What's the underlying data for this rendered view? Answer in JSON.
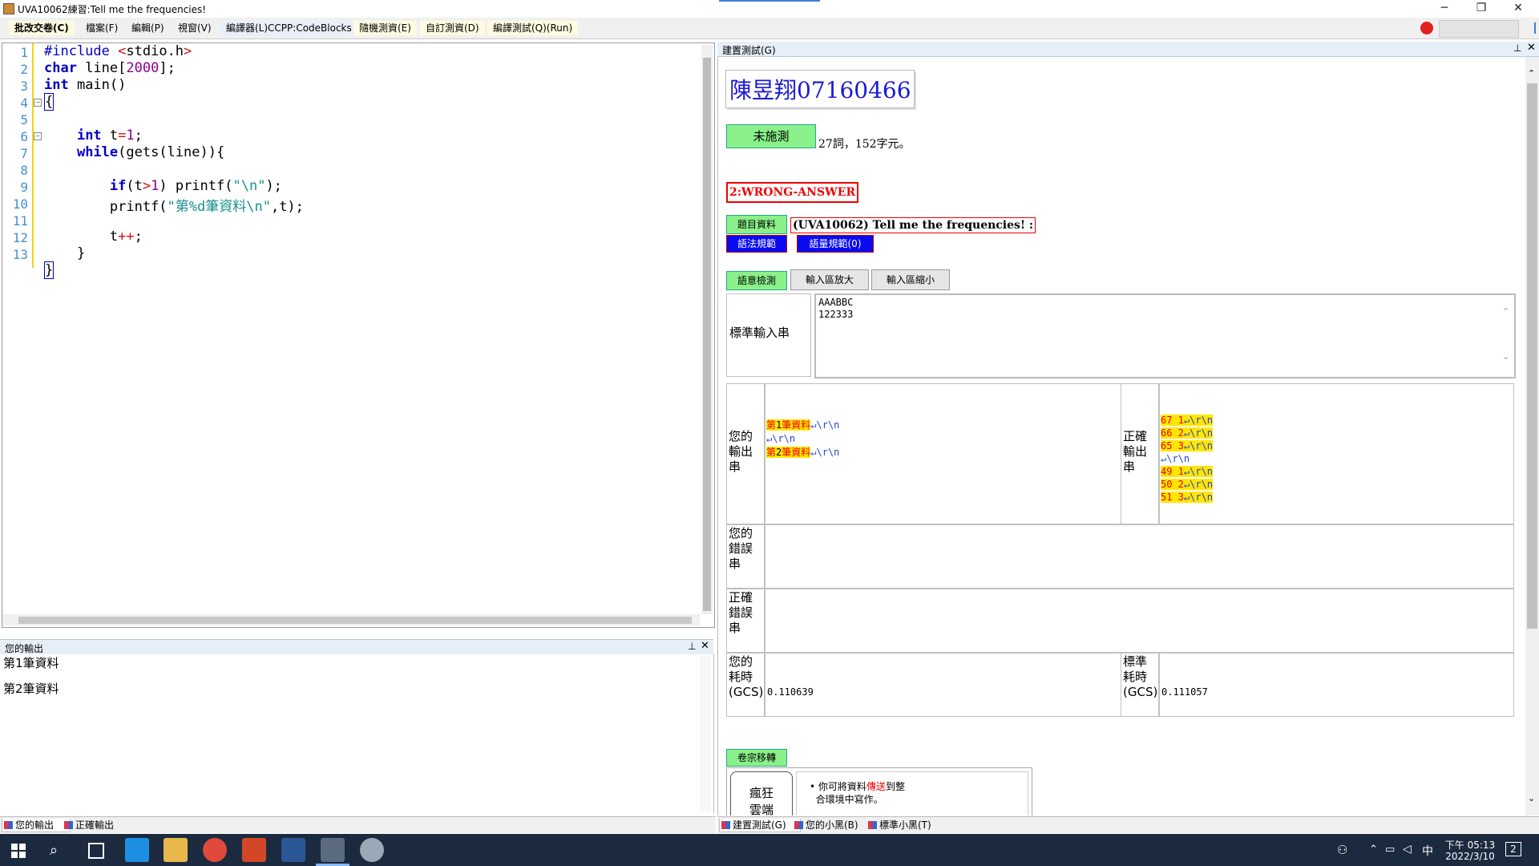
{
  "window": {
    "title": "UVA10062練習:Tell me the frequencies!",
    "min": "─",
    "max": "❐",
    "close": "✕"
  },
  "menu": [
    {
      "label": "批改交卷(C)"
    },
    {
      "label": "檔案(F)"
    },
    {
      "label": "編輯(P)"
    },
    {
      "label": "視窗(V)"
    },
    {
      "label": "編譯器(L)CCPP:CodeBlocks"
    },
    {
      "label": "隨機測資(E)"
    },
    {
      "label": "自訂測資(D)"
    },
    {
      "label": "編譯測試(Q)(Run)"
    }
  ],
  "editor": {
    "line_numbers": [
      "1",
      "2",
      "3",
      "4",
      "5",
      "6",
      "7",
      "8",
      "9",
      "10",
      "11",
      "12",
      "13"
    ]
  },
  "output_panel": {
    "title": "您的輸出",
    "lines": [
      "第1筆資料",
      "第2筆資料"
    ]
  },
  "bottom_tabs_left": [
    "您的輸出",
    "正確輸出"
  ],
  "bottom_tabs_right": [
    "建置測試(G)",
    "您的小黑(B)",
    "標準小黑(T)"
  ],
  "right_panel": {
    "title": "建置測試(G)",
    "student": "陳昱翔07160466",
    "status_button": "未施測",
    "stats": "27詞，152字元。",
    "result": "2:WRONG-ANSWER",
    "problem_button": "題目資料",
    "problem_title": "(UVA10062) Tell me the frequencies! :",
    "syntax_button": "語法規範",
    "vocab_button": "語量規範(0)",
    "semantic_button": "語意檢測",
    "enlarge_button": "輸入區放大",
    "shrink_button": "輸入區縮小",
    "std_input_label": "標準輸入串",
    "std_input": [
      "AAABBC",
      "122333"
    ],
    "your_output_label": "您的輸出串",
    "correct_output_label": "正確輸出串",
    "your_error_label": "您的錯誤串",
    "correct_error_label": "正確錯誤串",
    "your_time_label": "您的耗時(GCS)",
    "your_time": "0.110639",
    "std_time_label": "標準耗時(GCS)",
    "std_time": "0.111057",
    "transfer_button": "卷宗移轉",
    "cloud_label": "瘋狂雲端",
    "cloud_note_a": "你可將資料",
    "cloud_note_red": "傳送",
    "cloud_note_b": "到整",
    "cloud_note_c": "合環境中寫作。"
  },
  "taskbar": {
    "time": "下午 05:13",
    "date": "2022/3/10",
    "ime": "中",
    "notif_count": "2"
  }
}
